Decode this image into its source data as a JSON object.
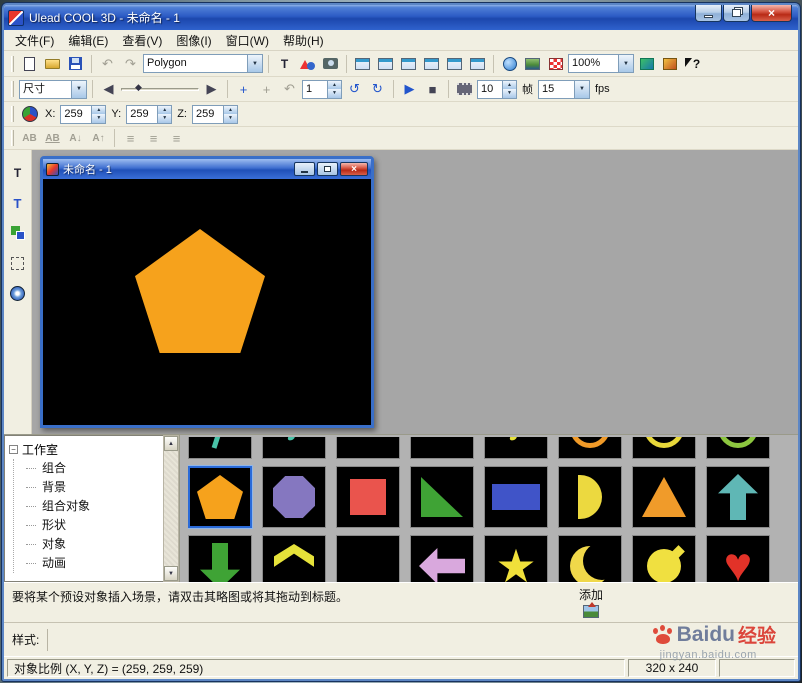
{
  "titlebar": {
    "title": "Ulead COOL 3D - 未命名 - 1"
  },
  "menubar": {
    "items": [
      "文件(F)",
      "编辑(E)",
      "查看(V)",
      "图像(I)",
      "窗口(W)",
      "帮助(H)"
    ]
  },
  "toolbar_main": {
    "shape_combo_value": "Polygon",
    "zoom_combo_value": "100%"
  },
  "toolbar_animation": {
    "size_combo_value": "尺寸",
    "current_frame": "1",
    "total_frames": "10",
    "frames_label": "帧",
    "fps_value": "15",
    "fps_label": "fps"
  },
  "toolbar_position": {
    "x_label": "X:",
    "x_value": "259",
    "y_label": "Y:",
    "y_value": "259",
    "z_label": "Z:",
    "z_value": "259"
  },
  "toolbar_text": {
    "buttons": [
      "AB",
      "AB",
      "A↓",
      "A↑"
    ]
  },
  "child_window": {
    "title": "未命名 - 1"
  },
  "easypalette": {
    "tree_root": "工作室",
    "tree_items": [
      "组合",
      "背景",
      "组合对象",
      "形状",
      "对象",
      "动画"
    ]
  },
  "hint_text": "要将某个预设对象插入场景，请双击其略图或将其拖动到标题。",
  "add_label": "添加",
  "style_label": "样式:",
  "statusbar": {
    "object_scale": "对象比例 (X, Y, Z) = (259, 259, 259)",
    "canvas_size": "320 x 240"
  },
  "watermark": {
    "brand": "Baidu",
    "suffix": "经验",
    "url": "jingyan.baidu.com"
  },
  "colors": {
    "pentagon_orange": "#f6a21c",
    "selection_blue": "#2a6ad8",
    "canvas_black": "#000000"
  },
  "canvas_object": {
    "shape": "pentagon",
    "color": "#f6a21c"
  },
  "gallery": {
    "top_row": [
      {
        "shape": "slash",
        "color": "#49c3a8"
      },
      {
        "shape": "note",
        "color": "#49c3a8"
      },
      {
        "shape": "none"
      },
      {
        "shape": "none"
      },
      {
        "shape": "note",
        "color": "#e6e23a"
      },
      {
        "shape": "ring",
        "color": "#f09a28"
      },
      {
        "shape": "ring",
        "color": "#e8d83a"
      },
      {
        "shape": "ring",
        "color": "#8cc63f"
      }
    ],
    "main_row": [
      {
        "shape": "pentagon",
        "color": "#f6a21c",
        "selected": true
      },
      {
        "shape": "octagon",
        "color": "#8577c0"
      },
      {
        "shape": "square",
        "color": "#ea544d"
      },
      {
        "shape": "right-triangle",
        "color": "#3fa335"
      },
      {
        "shape": "rectangle",
        "color": "#4054c8"
      },
      {
        "shape": "semicircle",
        "color": "#ecd93f"
      },
      {
        "shape": "triangle",
        "color": "#f09b2a"
      },
      {
        "shape": "arrow-up",
        "color": "#5fb7b5"
      }
    ],
    "bottom_row": [
      {
        "shape": "arrow-down",
        "color": "#3fa335"
      },
      {
        "shape": "chevron",
        "color": "#e6e23a"
      },
      {
        "shape": "none"
      },
      {
        "shape": "arrow-left",
        "color": "#d9a8dd"
      },
      {
        "shape": "star",
        "color": "#f0e03a"
      },
      {
        "shape": "crescent",
        "color": "#f0d84a"
      },
      {
        "shape": "lemon",
        "color": "#f0e040"
      },
      {
        "shape": "heart",
        "color": "#e23228"
      }
    ]
  },
  "icons": {
    "undo": "↶",
    "redo": "↷",
    "rotate_left": "↺",
    "rotate_right": "↻",
    "play": "▶",
    "stop": "■",
    "step_back": "◀",
    "step_forward": "▶",
    "dropdown": "▼",
    "spin_up": "▲",
    "spin_down": "▼",
    "scroll_up": "▲",
    "scroll_down": "▼",
    "align": "≡",
    "help": "?",
    "close": "×",
    "tree_collapse": "−",
    "slider_thumb": "◆",
    "text_tool": "T",
    "plus": "+"
  }
}
